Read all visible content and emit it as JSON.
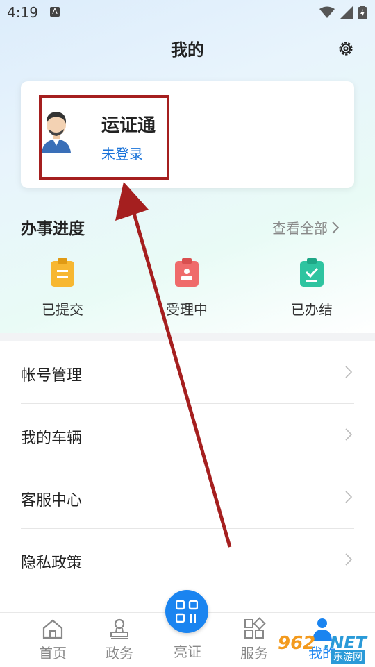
{
  "status_bar": {
    "time": "4:19",
    "notification_glyph": "A"
  },
  "header": {
    "title": "我的",
    "settings_icon": "gear-icon"
  },
  "profile": {
    "app_name": "运证通",
    "login_status": "未登录"
  },
  "progress": {
    "title": "办事进度",
    "view_all": "查看全部",
    "items": [
      {
        "label": "已提交",
        "color": "#f7b731"
      },
      {
        "label": "受理中",
        "color": "#ef6b6b"
      },
      {
        "label": "已办结",
        "color": "#2ec4a0"
      }
    ]
  },
  "menu": [
    {
      "label": "帐号管理"
    },
    {
      "label": "我的车辆"
    },
    {
      "label": "客服中心"
    },
    {
      "label": "隐私政策"
    }
  ],
  "bottom_nav": [
    {
      "label": "首页",
      "icon": "home-icon"
    },
    {
      "label": "政务",
      "icon": "stamp-icon"
    },
    {
      "label": "亮证",
      "icon": "qr-code-icon"
    },
    {
      "label": "服务",
      "icon": "grid-icon"
    },
    {
      "label": "我的",
      "icon": "person-icon"
    }
  ],
  "watermark": {
    "mark": "962",
    "net": ".NET",
    "site": "乐游网"
  },
  "colors": {
    "accent": "#1a84f0",
    "link": "#1a73d9",
    "annotation": "#a51f1f"
  }
}
